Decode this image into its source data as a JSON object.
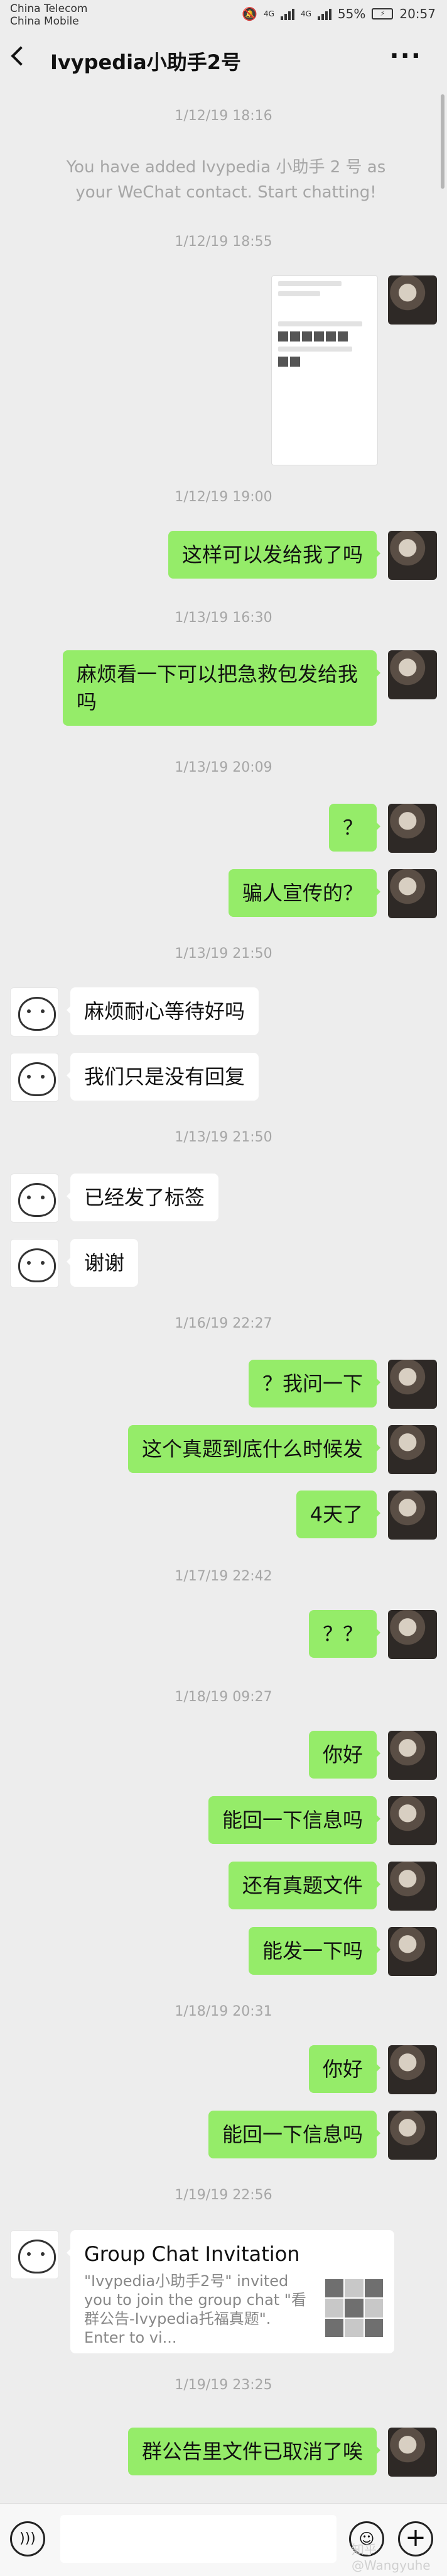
{
  "status_bar": {
    "carrier_1": "China Telecom",
    "carrier_2": "China Mobile",
    "net_1": "4G",
    "net_2": "4G",
    "battery": "55%",
    "time": "20:57"
  },
  "header": {
    "title": "Ivypedia小助手2号",
    "more_icon": "more-icon",
    "back_icon": "back-arrow-icon"
  },
  "timestamps": [
    "1/12/19 18:16",
    "1/12/19 18:55",
    "1/12/19 19:00",
    "1/13/19 16:30",
    "1/13/19 20:09",
    "1/13/19 21:50",
    "1/13/19 21:50",
    "1/16/19 22:27",
    "1/17/19 22:42",
    "1/18/19 09:27",
    "1/18/19 20:31",
    "1/19/19 22:56",
    "1/19/19 23:25"
  ],
  "system_message": "You have added Ivypedia 小助手 2 号 as your WeChat contact. Start chatting!",
  "messages": {
    "m1": "这样可以发给我了吗",
    "m2": "麻烦看一下可以把急救包发给我吗",
    "m3": "？",
    "m4": "骗人宣传的？",
    "m5": "麻烦耐心等待好吗",
    "m6": "我们只是没有回复",
    "m7": "已经发了标签",
    "m8": "谢谢",
    "m9": "？我问一下",
    "m10": "这个真题到底什么时候发",
    "m11": "4天了",
    "m12": "？？",
    "m13": "你好",
    "m14": "能回一下信息吗",
    "m15": "还有真题文件",
    "m16": "能发一下吗",
    "m17": "你好",
    "m18": "能回一下信息吗",
    "m19": "群公告里文件已取消了唉"
  },
  "group_invite": {
    "title": "Group Chat Invitation",
    "description": "\"Ivypedia小助手2号\" invited you to join the group chat \"看群公告-Ivypedia托福真题\". Enter to vi..."
  },
  "input_bar": {
    "placeholder": "",
    "voice_icon": "voice-icon",
    "emoji_icon": "emoji-icon",
    "plus_icon": "plus-icon"
  },
  "watermark": "知乎 @Wangyuhe",
  "colors": {
    "background": "#ededed",
    "my_bubble": "#95ec69",
    "their_bubble": "#ffffff"
  }
}
